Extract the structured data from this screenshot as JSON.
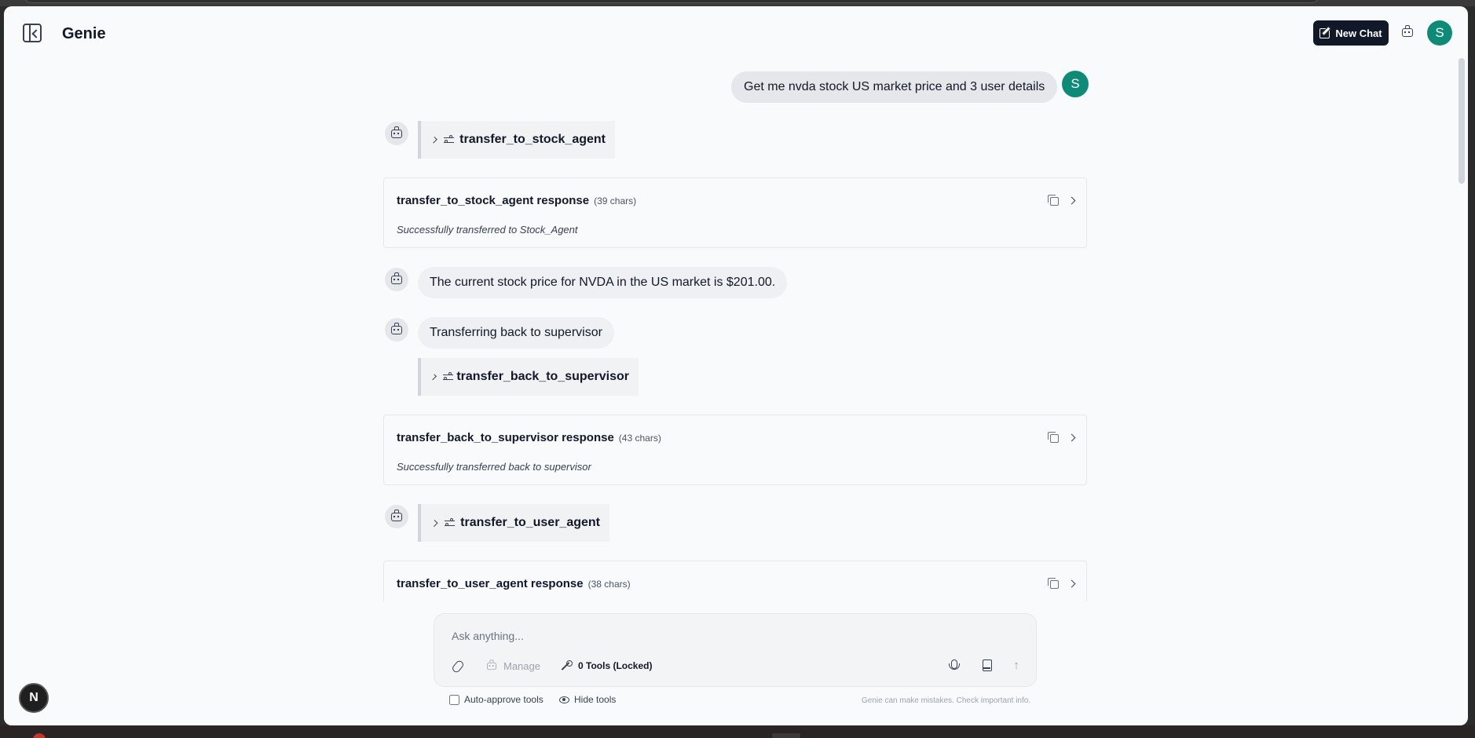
{
  "header": {
    "title": "Genie",
    "new_chat_label": "New Chat",
    "avatar_initial": "S"
  },
  "messages": {
    "user_message": "Get me nvda stock US market price and 3 user details",
    "user_initial": "S",
    "tool_call_1": "transfer_to_stock_agent",
    "response_1": {
      "title": "transfer_to_stock_agent response",
      "chars": "(39 chars)",
      "body": "Successfully transferred to Stock_Agent"
    },
    "assistant_text_1": "The current stock price for NVDA in the US market is $201.00.",
    "assistant_text_2": "Transferring back to supervisor",
    "tool_call_2": "transfer_back_to_supervisor",
    "response_2": {
      "title": "transfer_back_to_supervisor response",
      "chars": "(43 chars)",
      "body": "Successfully transferred back to supervisor"
    },
    "tool_call_3": "transfer_to_user_agent",
    "response_3": {
      "title": "transfer_to_user_agent response",
      "chars": "(38 chars)"
    }
  },
  "composer": {
    "placeholder": "Ask anything...",
    "manage_label": "Manage",
    "tools_label": "0 Tools (Locked)",
    "auto_approve_label": "Auto-approve tools",
    "hide_tools_label": "Hide tools",
    "disclaimer": "Genie can make mistakes. Check important info."
  },
  "dev_badge": "N",
  "colors": {
    "accent_avatar": "#0f8a78",
    "new_chat_bg": "#111827",
    "background": "#f8fafc"
  }
}
